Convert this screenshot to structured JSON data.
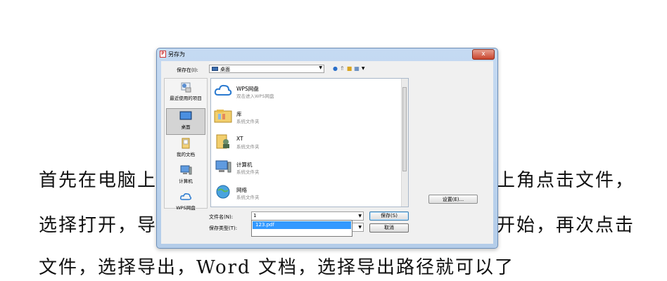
{
  "document": {
    "line1": "首先在电脑上",
    "line1_right": "上角点击文件，",
    "line2": "选择打开，导",
    "line2_right": "开始，再次点击",
    "line3": "文件，选择导出，Word 文档，选择导出路径就可以了"
  },
  "dialog": {
    "title": "另存为",
    "close": "x",
    "save_in_label": "保存在(I):",
    "location": "桌面",
    "places": [
      {
        "label": "最近使用的项目",
        "icon": "recent-items-icon"
      },
      {
        "label": "桌面",
        "icon": "desktop-icon"
      },
      {
        "label": "我的文档",
        "icon": "my-documents-icon"
      },
      {
        "label": "计算机",
        "icon": "computer-icon"
      },
      {
        "label": "WPS网盘",
        "icon": "wps-cloud-icon"
      }
    ],
    "files": [
      {
        "name": "WPS网盘",
        "sub": "双击进入WPS网盘",
        "icon": "cloud-icon"
      },
      {
        "name": "库",
        "sub": "系统文件夹",
        "icon": "library-icon"
      },
      {
        "name": "XT",
        "sub": "系统文件夹",
        "icon": "user-folder-icon"
      },
      {
        "name": "计算机",
        "sub": "系统文件夹",
        "icon": "computer-icon"
      },
      {
        "name": "网络",
        "sub": "系统文件夹",
        "icon": "network-icon"
      }
    ],
    "settings_label": "设置(E)...",
    "filename_label": "文件名(N):",
    "filename_value": "1",
    "suggestion": "123.pdf",
    "filetype_label": "保存类型(T):",
    "filetype_value": "",
    "save_label": "保存(S)",
    "cancel_label": "取消"
  },
  "colors": {
    "frame": "#b4cde9",
    "selection": "#3399ff"
  }
}
